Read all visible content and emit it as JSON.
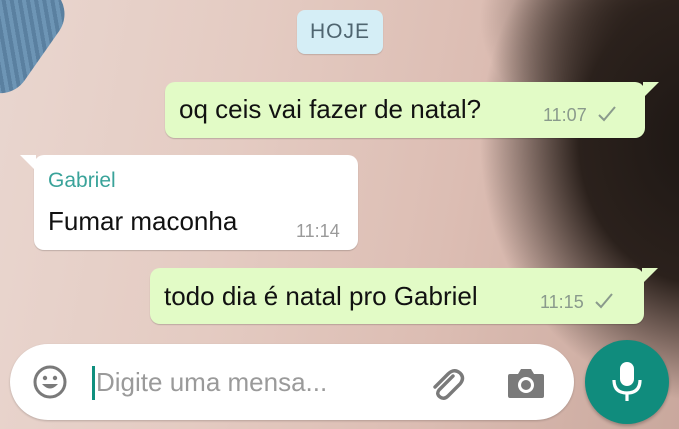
{
  "chat": {
    "date_label": "HOJE",
    "messages": [
      {
        "direction": "outgoing",
        "text": "oq ceis vai fazer de natal?",
        "time": "11:07",
        "status": "sent-check"
      },
      {
        "direction": "incoming",
        "sender": "Gabriel",
        "text": "Fumar maconha",
        "time": "11:14"
      },
      {
        "direction": "outgoing",
        "text": "todo dia é natal pro Gabriel",
        "time": "11:15",
        "status": "sent-check"
      }
    ]
  },
  "composer": {
    "placeholder": "Digite uma mensa...",
    "value": "",
    "icons": {
      "emoji": "smiley-icon",
      "attach": "paperclip-icon",
      "camera": "camera-icon",
      "mic": "microphone-icon"
    }
  },
  "colors": {
    "outgoing_bubble": "#e2fbc6",
    "incoming_bubble": "#ffffff",
    "sender_name": "#3aa39a",
    "date_chip": "#d5eef6",
    "mic_button": "#108c7d"
  }
}
